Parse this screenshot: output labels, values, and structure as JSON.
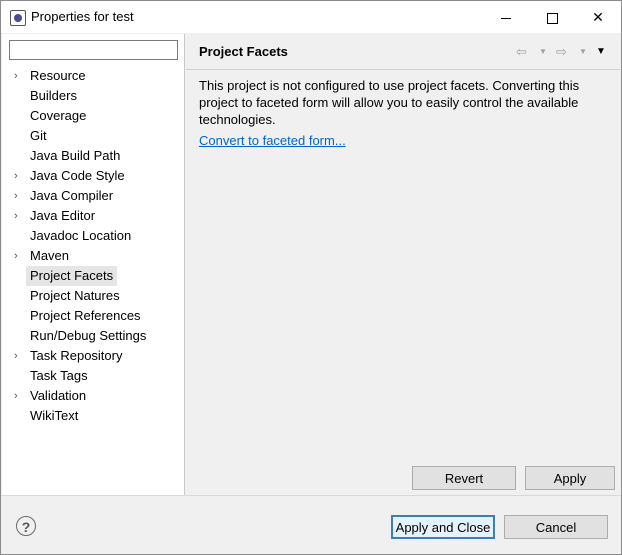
{
  "window": {
    "title": "Properties for test",
    "icon": "eclipse-properties-icon",
    "controls": {
      "minimize": "minimize-icon",
      "maximize": "maximize-icon",
      "close": "✕"
    }
  },
  "sidebar": {
    "filter_value": "",
    "items": [
      {
        "label": "Resource",
        "expandable": true
      },
      {
        "label": "Builders",
        "expandable": false
      },
      {
        "label": "Coverage",
        "expandable": false
      },
      {
        "label": "Git",
        "expandable": false
      },
      {
        "label": "Java Build Path",
        "expandable": false
      },
      {
        "label": "Java Code Style",
        "expandable": true
      },
      {
        "label": "Java Compiler",
        "expandable": true
      },
      {
        "label": "Java Editor",
        "expandable": true
      },
      {
        "label": "Javadoc Location",
        "expandable": false
      },
      {
        "label": "Maven",
        "expandable": true
      },
      {
        "label": "Project Facets",
        "expandable": false,
        "selected": true
      },
      {
        "label": "Project Natures",
        "expandable": false
      },
      {
        "label": "Project References",
        "expandable": false
      },
      {
        "label": "Run/Debug Settings",
        "expandable": false
      },
      {
        "label": "Task Repository",
        "expandable": true
      },
      {
        "label": "Task Tags",
        "expandable": false
      },
      {
        "label": "Validation",
        "expandable": true
      },
      {
        "label": "WikiText",
        "expandable": false
      }
    ]
  },
  "main": {
    "title": "Project Facets",
    "description": "This project is not configured to use project facets. Converting this project to faceted form will allow you to easily control the available technologies.",
    "link": "Convert to faceted form...",
    "nav": {
      "back": "⇦",
      "forward": "⇨",
      "dropdown": "▼",
      "menu": "▼"
    },
    "revert_label": "Revert",
    "apply_label": "Apply"
  },
  "footer": {
    "help": "?",
    "apply_close_label": "Apply and Close",
    "cancel_label": "Cancel"
  }
}
